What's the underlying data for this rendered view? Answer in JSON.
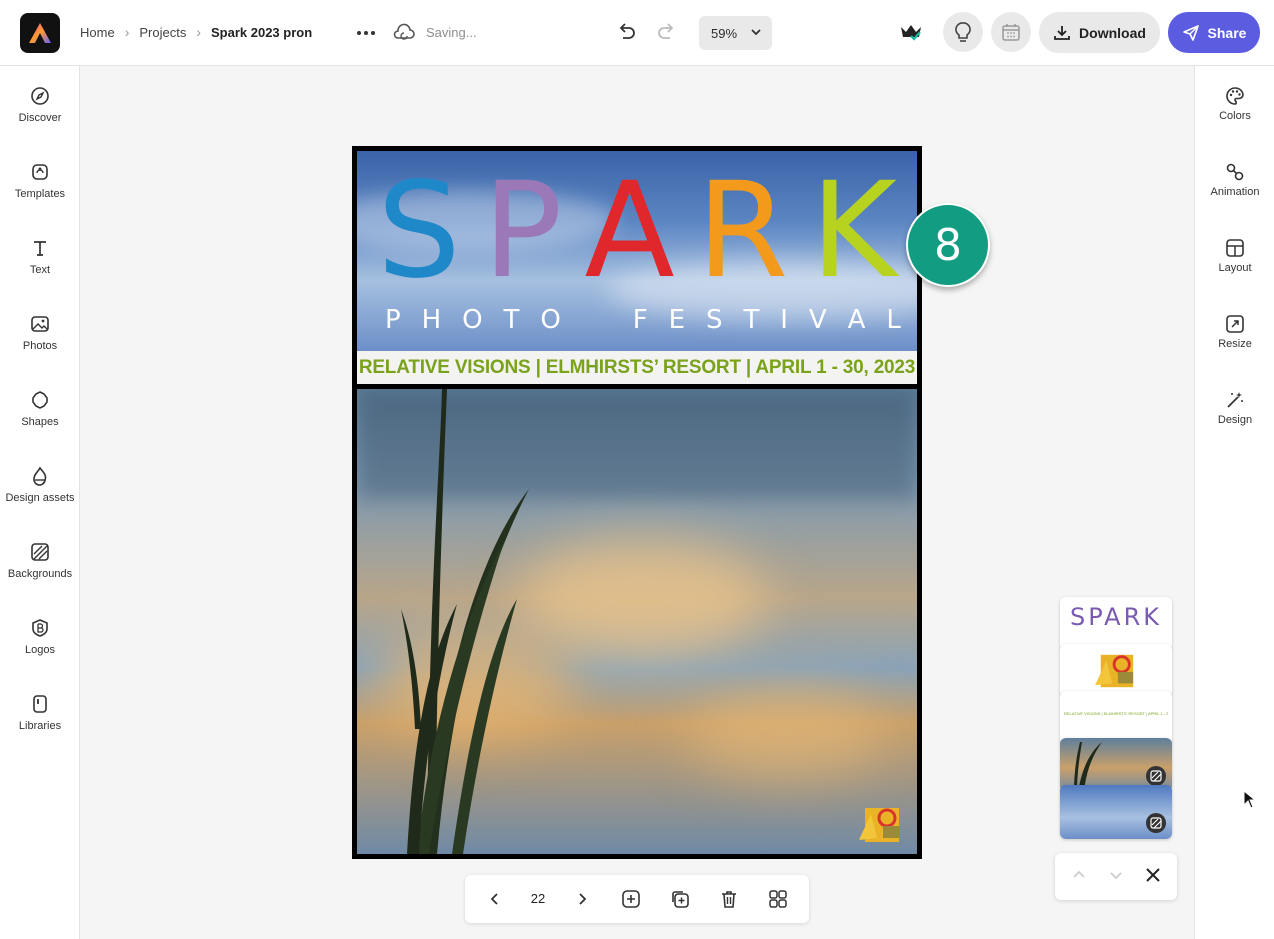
{
  "header": {
    "breadcrumb": [
      "Home",
      "Projects",
      "Spark 2023 pron"
    ],
    "status": "Saving...",
    "zoom": "59%",
    "download_label": "Download",
    "share_label": "Share"
  },
  "left_panel": {
    "items": [
      {
        "label": "Discover",
        "icon": "compass-icon"
      },
      {
        "label": "Templates",
        "icon": "templates-icon"
      },
      {
        "label": "Text",
        "icon": "text-icon"
      },
      {
        "label": "Photos",
        "icon": "photo-icon"
      },
      {
        "label": "Shapes",
        "icon": "shapes-icon"
      },
      {
        "label": "Design assets",
        "icon": "design-assets-icon"
      },
      {
        "label": "Backgrounds",
        "icon": "backgrounds-icon"
      },
      {
        "label": "Logos",
        "icon": "logos-icon"
      },
      {
        "label": "Libraries",
        "icon": "libraries-icon"
      }
    ]
  },
  "right_panel": {
    "items": [
      {
        "label": "Colors",
        "icon": "palette-icon"
      },
      {
        "label": "Animation",
        "icon": "animation-icon"
      },
      {
        "label": "Layout",
        "icon": "layout-icon"
      },
      {
        "label": "Resize",
        "icon": "resize-icon"
      },
      {
        "label": "Design",
        "icon": "magic-wand-icon"
      }
    ]
  },
  "canvas": {
    "title_letters": [
      {
        "char": "S",
        "color": "#1e88c9"
      },
      {
        "char": "P",
        "color": "#9b79b8"
      },
      {
        "char": "A",
        "color": "#e0282c"
      },
      {
        "char": "R",
        "color": "#f39a1d"
      },
      {
        "char": "K",
        "color": "#b7d320"
      }
    ],
    "subtitle_letters": [
      "P",
      "H",
      "O",
      "T",
      "O",
      "F",
      "E",
      "S",
      "T",
      "I",
      "V",
      "A",
      "L"
    ],
    "banner_text": "RELATIVE VISIONS | ELMHIRSTS’ RESORT | APRIL 1 - 30, 2023",
    "step_badge": "8"
  },
  "page_nav": {
    "page_number": "22"
  },
  "layers_panel": {
    "layer_thumb_text": "SPARK",
    "banner_thumb_text": "RELATIVE VISIONS | ELMHIRSTS’ RESORT | APRIL 1 - 30, 2023"
  },
  "colors": {
    "accent": "#5c5ce0",
    "badge": "#129d83",
    "banner_text": "#7aa21a"
  }
}
